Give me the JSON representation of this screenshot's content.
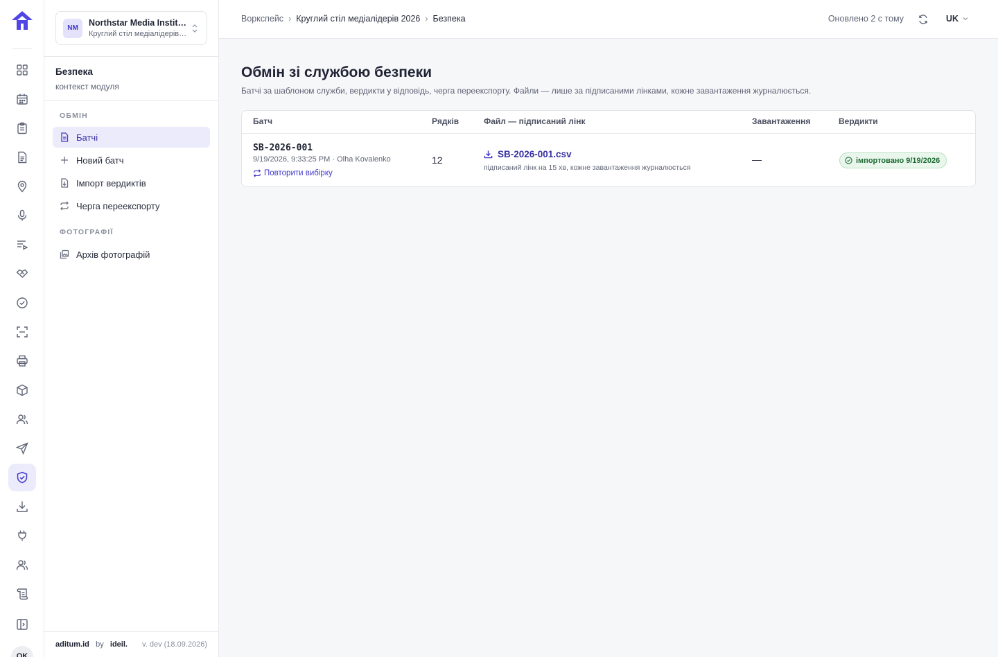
{
  "rail": {
    "items": [
      {
        "icon": "dashboard-icon"
      },
      {
        "icon": "calendar-icon"
      },
      {
        "icon": "clipboard-icon"
      },
      {
        "icon": "document-icon"
      },
      {
        "icon": "location-icon"
      },
      {
        "icon": "microphone-icon"
      },
      {
        "icon": "playlist-icon"
      },
      {
        "icon": "handshake-icon"
      },
      {
        "icon": "check-circle-icon"
      },
      {
        "icon": "scan-icon"
      },
      {
        "icon": "printer-icon"
      },
      {
        "icon": "package-icon"
      },
      {
        "icon": "users-icon"
      },
      {
        "icon": "send-icon"
      },
      {
        "icon": "shield-check-icon",
        "active": true
      },
      {
        "icon": "download-icon"
      },
      {
        "icon": "plug-icon"
      },
      {
        "icon": "people-icon"
      },
      {
        "icon": "scroll-icon"
      },
      {
        "icon": "sidebar-toggle-icon"
      }
    ],
    "avatar": "OK"
  },
  "org": {
    "initials": "NM",
    "name": "Northstar Media Institute",
    "event": "Круглий стіл медіалідерів 2026"
  },
  "module": {
    "title": "Безпека",
    "subtitle": "контекст модуля"
  },
  "nav": {
    "section_exchange": "ОБМІН",
    "items_exchange": [
      {
        "label": "Батчі",
        "icon": "file-icon",
        "active": true
      },
      {
        "label": "Новий батч",
        "icon": "plus-icon"
      },
      {
        "label": "Імпорт вердиктів",
        "icon": "file-import-icon"
      },
      {
        "label": "Черга переекспорту",
        "icon": "repeat-icon"
      }
    ],
    "section_photos": "ФОТОГРАФІЇ",
    "items_photos": [
      {
        "label": "Архів фотографій",
        "icon": "photo-archive-icon"
      }
    ]
  },
  "footer": {
    "brand": "aditum.id",
    "by": "by",
    "company": "ideil.",
    "version": "v. dev (18.09.2026)"
  },
  "topbar": {
    "breadcrumb": [
      "Воркспейс",
      "Круглий стіл медіалідерів 2026",
      "Безпека"
    ],
    "updated": "Оновлено 2 с тому",
    "language": "UK"
  },
  "page": {
    "title": "Обмін зі службою безпеки",
    "subtitle": "Батчі за шаблоном служби, вердикти у відповідь, черга переекспорту. Файли — лише за підписаними лінками, кожне завантаження журналюється."
  },
  "table": {
    "headers": {
      "batch": "Батч",
      "rows": "Рядків",
      "file": "Файл — підписаний лінк",
      "downloads": "Завантаження",
      "verdicts": "Вердикти"
    },
    "rows": [
      {
        "id": "SB-2026-001",
        "meta": "9/19/2026, 9:33:25 PM · Olha Kovalenko",
        "retry": "Повторити вибірку",
        "row_count": "12",
        "file": "SB-2026-001.csv",
        "file_note": "підписаний лінк на 15 хв, кожне завантаження журналюється",
        "downloads": "—",
        "verdict": "імпортовано 9/19/2026"
      }
    ]
  },
  "colors": {
    "accent": "#4338ca",
    "accent_bg": "#ecebfb",
    "success_bg": "#e9f6ec",
    "success_text": "#1f6b34"
  }
}
